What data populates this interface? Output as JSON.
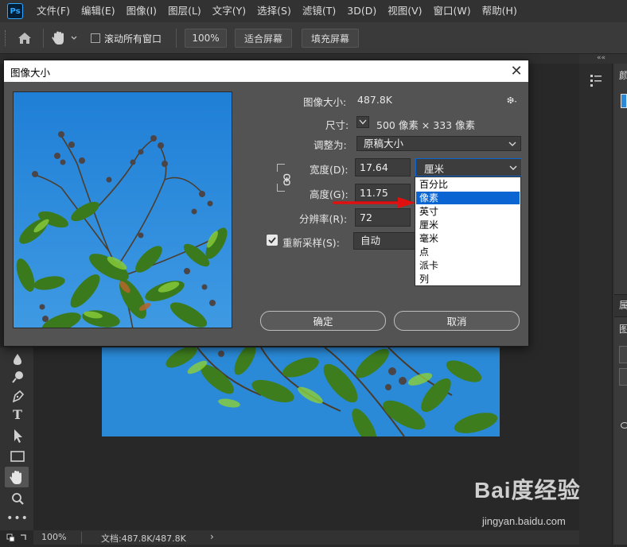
{
  "app": {
    "logo": "Ps",
    "menu": [
      "文件(F)",
      "编辑(E)",
      "图像(I)",
      "图层(L)",
      "文字(Y)",
      "选择(S)",
      "滤镜(T)",
      "3D(D)",
      "视图(V)",
      "窗口(W)",
      "帮助(H)"
    ]
  },
  "options_bar": {
    "scroll_all_label": "滚动所有窗口",
    "zoom_value": "100%",
    "fit_screen_label": "适合屏幕",
    "fill_screen_label": "填充屏幕"
  },
  "right_panel": {
    "collapse_glyph": "««",
    "tab_label_1": "颜",
    "tab_label_2": "属",
    "tab_label_3": "图"
  },
  "status_bar": {
    "zoom": "100%",
    "doc_info": "文档:487.8K/487.8K"
  },
  "dialog": {
    "title": "图像大小",
    "image_size_label": "图像大小:",
    "image_size_value": "487.8K",
    "dimensions_label": "尺寸:",
    "dimensions_value": "500 像素 × 333 像素",
    "fit_to_label": "调整为:",
    "fit_to_value": "原稿大小",
    "width_label": "宽度(D):",
    "width_value": "17.64",
    "width_unit": "厘米",
    "height_label": "高度(G):",
    "height_value": "11.75",
    "resolution_label": "分辨率(R):",
    "resolution_value": "72",
    "resample_label": "重新采样(S):",
    "resample_value": "自动",
    "resample_checked": true,
    "ok_label": "确定",
    "cancel_label": "取消"
  },
  "unit_dropdown": {
    "options": [
      "百分比",
      "像素",
      "英寸",
      "厘米",
      "毫米",
      "点",
      "派卡",
      "列"
    ],
    "highlighted": "像素"
  },
  "watermark": {
    "brand": "Bai度经验",
    "url": "jingyan.baidu.com"
  },
  "colors": {
    "accent_selection": "#0a64d1",
    "arrow": "#e01010",
    "sky": "#2a8ad8"
  }
}
